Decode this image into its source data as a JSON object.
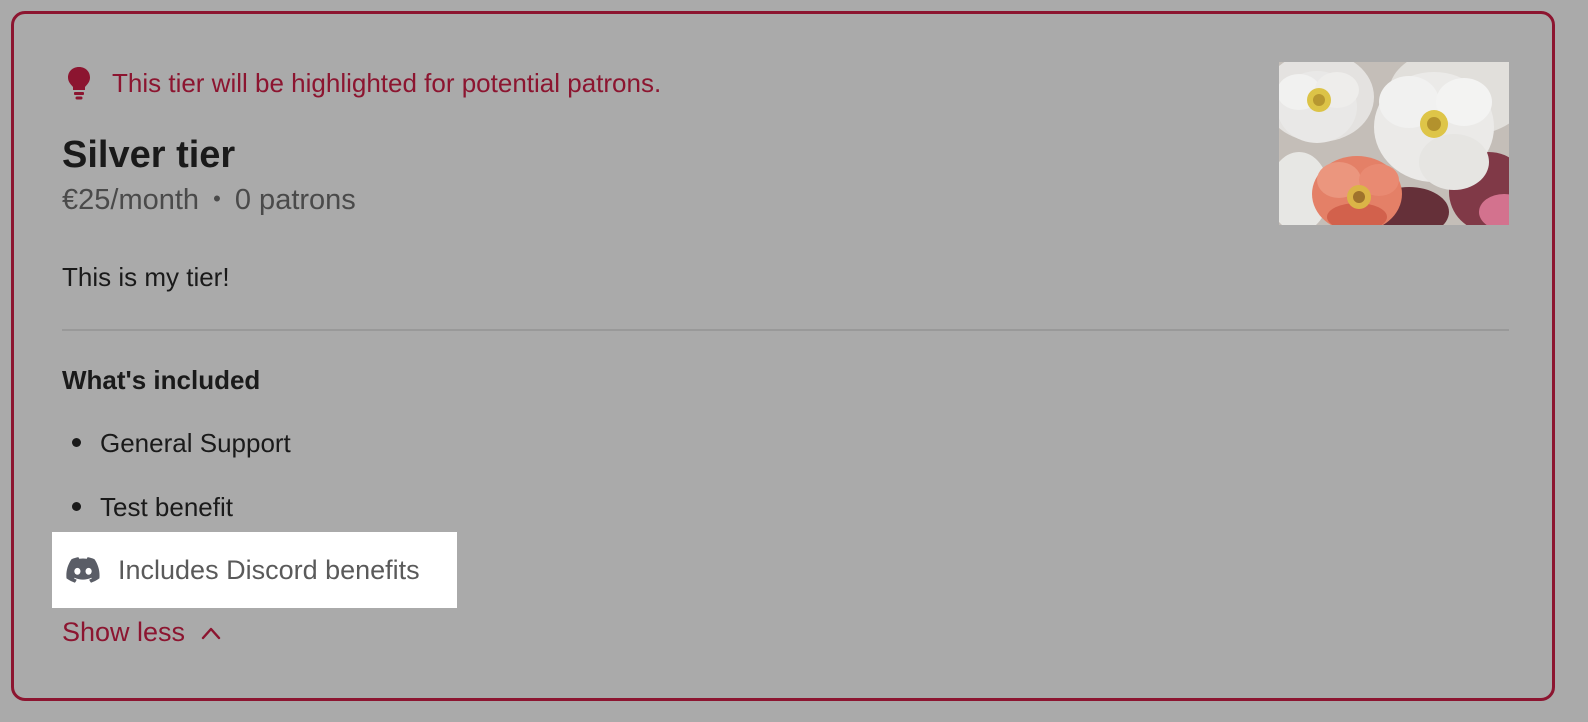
{
  "highlight_note": "This tier will be highlighted for potential patrons.",
  "tier": {
    "title": "Silver tier",
    "price": "€25/month",
    "separator": "•",
    "patrons": "0 patrons",
    "description": "This is my tier!",
    "image_alt": "Tier image of white and coral peonies"
  },
  "included": {
    "heading": "What's included",
    "benefits": [
      "General Support",
      "Test benefit"
    ]
  },
  "discord": {
    "label": "Includes Discord benefits",
    "icon": "discord-icon"
  },
  "show_less": {
    "label": "Show less",
    "icon": "chevron-up-icon"
  },
  "colors": {
    "accent": "#8c1530",
    "overlay": "#aaaaaa",
    "highlight_box": "#ffffff"
  }
}
